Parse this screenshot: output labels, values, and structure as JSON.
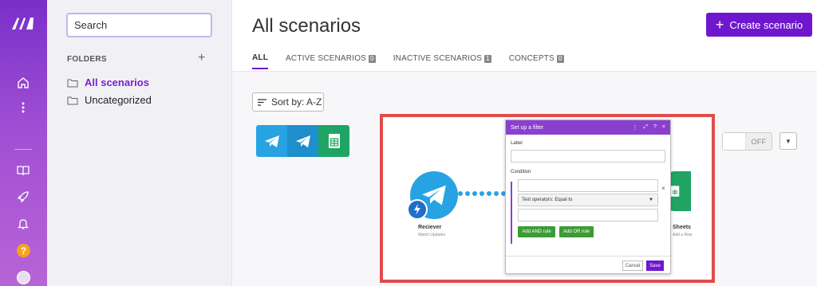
{
  "search": {
    "placeholder": "Search"
  },
  "folders": {
    "title": "FOLDERS",
    "add": "+",
    "items": [
      {
        "label": "All scenarios",
        "active": true
      },
      {
        "label": "Uncategorized",
        "active": false
      }
    ]
  },
  "header": {
    "title": "All scenarios",
    "create_label": "Create scenario",
    "tabs": [
      {
        "label": "ALL",
        "count": ""
      },
      {
        "label": "ACTIVE SCENARIOS",
        "count": "0"
      },
      {
        "label": "INACTIVE SCENARIOS",
        "count": "1"
      },
      {
        "label": "CONCEPTS",
        "count": "0"
      }
    ]
  },
  "toolbar": {
    "sort_label": "Sort by: A-Z"
  },
  "scenario": {
    "toggle_label": "OFF"
  },
  "canvas": {
    "receiver_label": "Reciever",
    "receiver_sub": "Watch Updates",
    "sheets_label": "Sheets",
    "sheets_sub": "Add a Row"
  },
  "filter_dialog": {
    "title": "Set up a filter",
    "label_field": "Label",
    "condition_label": "Condition",
    "operator": "Text operators: Equal to",
    "and_rule": "Add AND rule",
    "or_rule": "Add OR rule",
    "cancel": "Cancel",
    "save": "Save"
  },
  "colors": {
    "brand": "#6f17cf",
    "telegram": "#27a3e3",
    "sheets": "#1fa463",
    "highlight": "#e24b4b"
  }
}
